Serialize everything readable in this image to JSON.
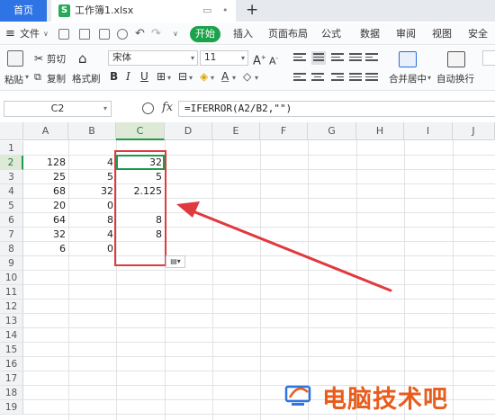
{
  "tabs": {
    "home": "首页",
    "file": "工作簿1.xlsx"
  },
  "menu": {
    "file": "文件",
    "start": "开始",
    "items": [
      "插入",
      "页面布局",
      "公式",
      "数据",
      "审阅",
      "视图",
      "安全"
    ]
  },
  "ribbon": {
    "paste": "粘贴",
    "cut": "剪切",
    "copy": "复制",
    "format_painter": "格式刷",
    "font_name": "宋体",
    "font_size": "11",
    "merge_center": "合并居中",
    "wrap_text": "自动换行"
  },
  "formula_bar": {
    "cell_ref": "C2",
    "fx": "fx",
    "formula": "=IFERROR(A2/B2,\"\")"
  },
  "sheet": {
    "columns": [
      "A",
      "B",
      "C",
      "D",
      "E",
      "F",
      "G",
      "H",
      "I",
      "J"
    ],
    "rows": [
      "1",
      "2",
      "3",
      "4",
      "5",
      "6",
      "7",
      "8",
      "9",
      "10",
      "11",
      "12",
      "13",
      "14",
      "15",
      "16",
      "17",
      "18",
      "19"
    ],
    "data": [
      {
        "a": "",
        "b": "",
        "c": ""
      },
      {
        "a": "128",
        "b": "4",
        "c": "32"
      },
      {
        "a": "25",
        "b": "5",
        "c": "5"
      },
      {
        "a": "68",
        "b": "32",
        "c": "2.125"
      },
      {
        "a": "20",
        "b": "0",
        "c": ""
      },
      {
        "a": "64",
        "b": "8",
        "c": "8"
      },
      {
        "a": "32",
        "b": "4",
        "c": "8"
      },
      {
        "a": "6",
        "b": "0",
        "c": ""
      }
    ]
  },
  "watermark": "电脑技术吧",
  "colors": {
    "accent_green": "#1e9a4a",
    "highlight_red": "#e0393e",
    "home_tab_blue": "#2f74e4"
  }
}
